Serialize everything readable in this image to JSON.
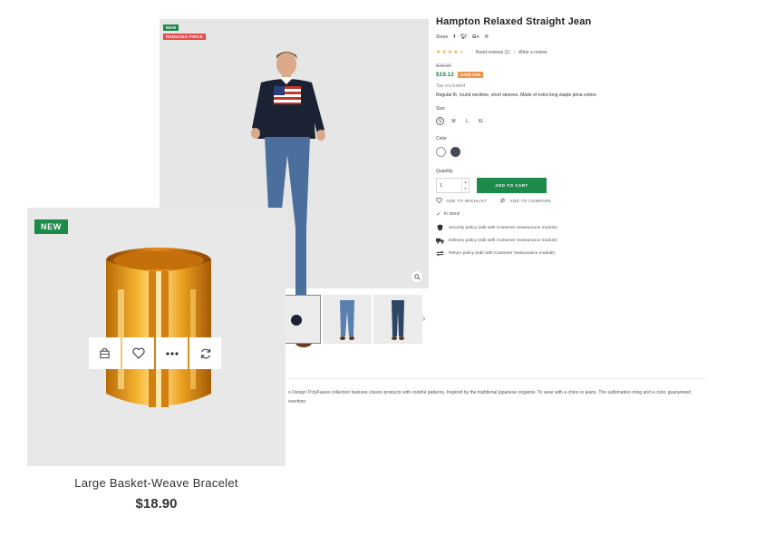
{
  "product": {
    "title": "Hampton Relaxed Straight Jean",
    "flags": {
      "new": "NEW",
      "reduced": "REDUCED PRICE"
    },
    "share_label": "Share",
    "share_icons": [
      "facebook-icon",
      "twitter-icon",
      "google-plus-icon",
      "pinterest-icon"
    ],
    "rating": {
      "value": 4,
      "max": 5
    },
    "read_reviews": "Read reviews (1)",
    "write_review": "Write a review",
    "old_price": "$23.90",
    "new_price": "$19.12",
    "save_badge": "SAVE 20%",
    "tax": "Tax excluded",
    "short_description": "Regular fit, round neckline, short sleeves. Made of extra long staple pima cotton.",
    "size_label": "Size",
    "sizes": [
      "S",
      "M",
      "L",
      "XL"
    ],
    "selected_size": "S",
    "color_label": "Color",
    "colors": [
      "#ffffff",
      "#434a54"
    ],
    "quantity_label": "Quantity",
    "quantity_value": "1",
    "add_to_cart": "ADD TO CART",
    "add_to_wishlist": "ADD TO WISHLIST",
    "add_to_compare": "ADD TO COMPARE",
    "stock": "In stock",
    "policies": [
      "Security policy (edit with Customer reassurance module)",
      "Delivery policy (edit with Customer reassurance module)",
      "Return policy (edit with Customer reassurance module)"
    ],
    "description": "o Design' PolyFaune collection features classic products with colorful patterns. Inspired by the traditional japanese origamis. To wear with a chino or jeans. The sublimation oring and a color, guaranteed overtime.",
    "accent_color": "#1d8a4a",
    "reduced_color": "#e44b4b",
    "save_color": "#f2934b"
  },
  "card": {
    "flag": "NEW",
    "title": "Large Basket-Weave Bracelet",
    "price": "$18.90",
    "actions": [
      "cart-icon",
      "heart-icon",
      "more-icon",
      "refresh-icon"
    ]
  }
}
